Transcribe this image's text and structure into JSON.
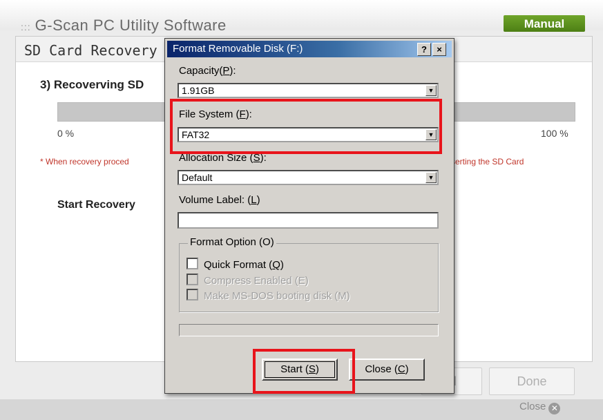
{
  "app": {
    "title_dots": ":::",
    "title": "G-Scan PC Utility Software",
    "manual_label": "Manual",
    "panel_title": "SD Card Recovery",
    "step_label": "3) Recoverving SD",
    "progress_percent": 0,
    "pct_start": "0 %",
    "pct_end": "100 %",
    "warning_left": "* When recovery proced",
    "warning_right": "serting the SD Card",
    "start_recovery": "Start Recovery",
    "cancel_label": "al",
    "done_label": "Done",
    "close_label": "Close"
  },
  "dialog": {
    "title": "Format Removable Disk (F:)",
    "help_btn": "?",
    "close_btn": "×",
    "capacity": {
      "label": "Capacity(",
      "key": "P",
      "tail": "):",
      "value": "1.91GB"
    },
    "file_system": {
      "label": "File System (",
      "key": "F",
      "tail": "):",
      "value": "FAT32"
    },
    "allocation_size": {
      "label": "Allocation Size (",
      "key": "S",
      "tail": "):",
      "value": "Default"
    },
    "volume_label": {
      "label": "Volume Label: (",
      "key": "L",
      "tail": ")",
      "value": ""
    },
    "format_option": {
      "title": "Format Option (O)",
      "quick_format": {
        "label": "Quick Format (",
        "key": "Q",
        "tail": ")",
        "checked": false,
        "enabled": true
      },
      "compress": {
        "label": "Compress Enabled (E)",
        "checked": false,
        "enabled": false
      },
      "msdos": {
        "label": "Make MS-DOS booting disk (M)",
        "checked": false,
        "enabled": false
      }
    },
    "start": {
      "label": "Start (",
      "key": "S",
      "tail": ")"
    },
    "close": {
      "label": "Close (",
      "key": "C",
      "tail": ")"
    }
  },
  "colors": {
    "highlight": "#e8141b",
    "titlebar": "#0a246a",
    "manual_green": "#5a8f1e"
  },
  "icons": [
    "dropdown-arrow-icon",
    "help-icon",
    "close-icon"
  ]
}
